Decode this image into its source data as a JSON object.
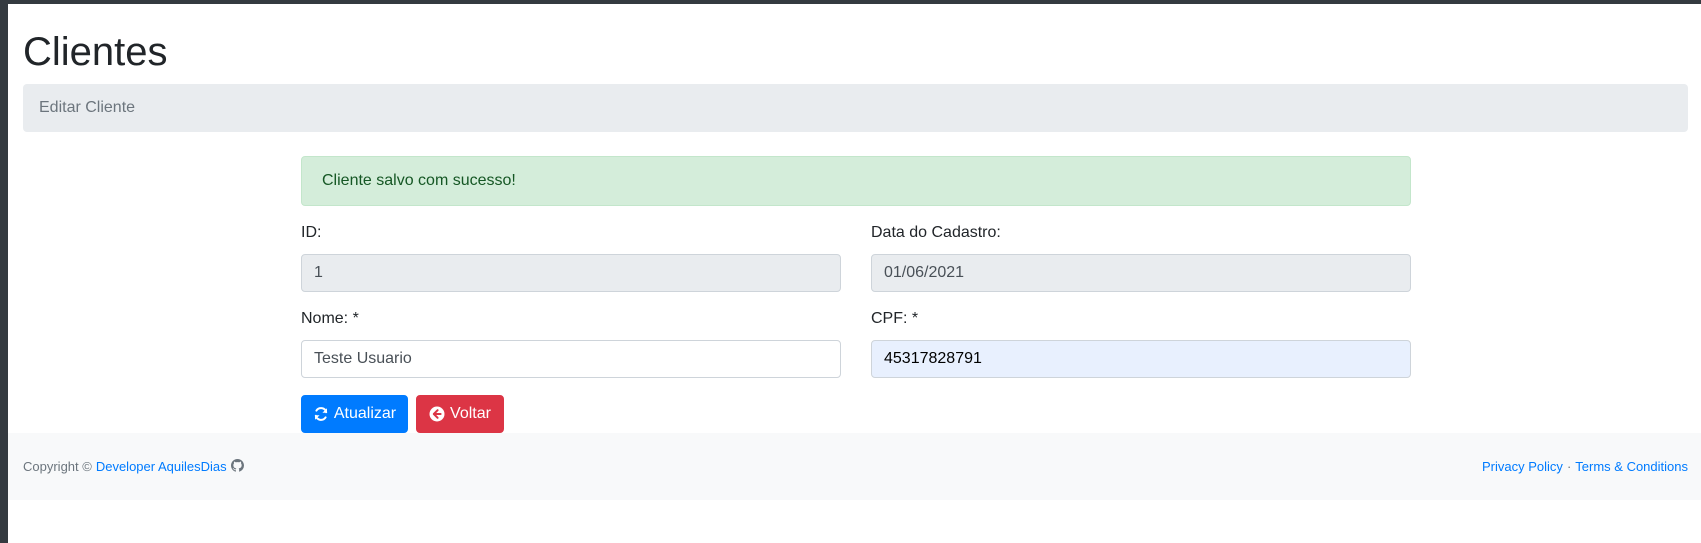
{
  "page": {
    "title": "Clientes"
  },
  "breadcrumb": {
    "current": "Editar Cliente"
  },
  "alert": {
    "message": "Cliente salvo com sucesso!",
    "color": "#d4edda"
  },
  "form": {
    "id": {
      "label": "ID:",
      "value": "1"
    },
    "data_cadastro": {
      "label": "Data do Cadastro:",
      "value": "01/06/2021"
    },
    "nome": {
      "label": "Nome: *",
      "value": "Teste Usuario"
    },
    "cpf": {
      "label": "CPF: *",
      "value": "45317828791"
    }
  },
  "buttons": {
    "update": {
      "label": "Atualizar",
      "icon": "refresh-icon",
      "color": "#007bff"
    },
    "back": {
      "label": "Voltar",
      "icon": "arrow-circle-left-icon",
      "color": "#dc3545"
    }
  },
  "footer": {
    "copyright": "Copyright ©",
    "developer_link": "Developer AquilesDias",
    "github_icon": "github-icon",
    "privacy": "Privacy Policy",
    "separator": "·",
    "terms": "Terms & Conditions"
  }
}
